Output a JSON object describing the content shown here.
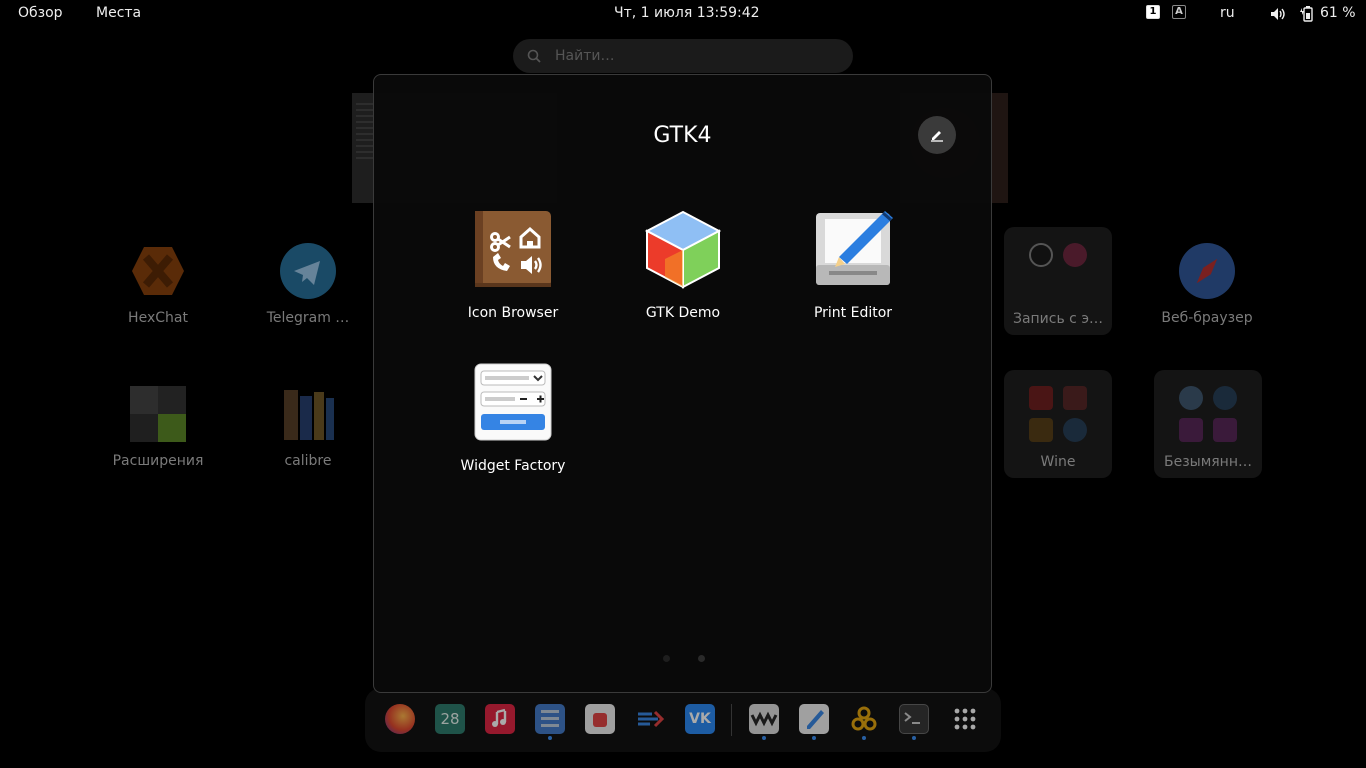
{
  "topbar": {
    "overview": "Обзор",
    "places": "Места",
    "clock": "Чт, 1 июля  13:59:42",
    "workspace_indicator": "1",
    "input_source_indicator": "A",
    "keyboard_layout": "ru",
    "battery_percent": "61 %"
  },
  "search": {
    "placeholder": "Найти…"
  },
  "background_apps": {
    "hexchat": "HexChat",
    "telegram": "Telegram …",
    "record": "Запись с э…",
    "web_browser": "Веб-браузер",
    "extensions": "Расширения",
    "calibre": "calibre",
    "wine": "Wine",
    "unnamed_folder": "Безымянн…"
  },
  "folder": {
    "title": "GTK4",
    "apps": [
      {
        "label": "Icon Browser",
        "icon": "icon-browser-icon"
      },
      {
        "label": "GTK Demo",
        "icon": "gtk-demo-icon"
      },
      {
        "label": "Print Editor",
        "icon": "print-editor-icon"
      },
      {
        "label": "Widget Factory",
        "icon": "widget-factory-icon"
      }
    ]
  },
  "dash": {
    "items": [
      "firefox",
      "calendar",
      "music",
      "files",
      "software",
      "planner",
      "vk",
      "wine-manager",
      "text-editor",
      "settings-nodes",
      "terminal",
      "show-apps"
    ],
    "calendar_day": "28"
  },
  "colors": {
    "accent": "#3584e4",
    "folder_bg": "#0a0a0a",
    "rename_button": "#3a3a3a"
  }
}
